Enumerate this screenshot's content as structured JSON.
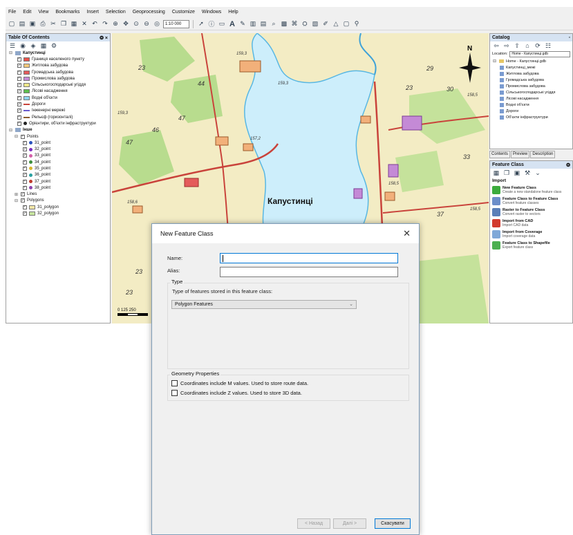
{
  "menu": [
    "File",
    "Edit",
    "View",
    "Bookmarks",
    "Insert",
    "Selection",
    "Geoprocessing",
    "Customize",
    "Windows",
    "Help"
  ],
  "toolbar": {
    "scale": "1:10 000"
  },
  "toc": {
    "title": "Table Of Contents",
    "pin": "❂ ×",
    "group1": "Капустинці",
    "layers": [
      {
        "label": "Границя населеного пункту",
        "color": "#e8524a"
      },
      {
        "label": "Житлова забудова",
        "color": "#f5c97a"
      },
      {
        "label": "Громадська забудова",
        "color": "#e45b5b"
      },
      {
        "label": "Промислова забудова",
        "color": "#c48ad6"
      },
      {
        "label": "Сільськогосподарські угіддя",
        "color": "#efe98a"
      },
      {
        "label": "Лісові насадження",
        "color": "#5fbf4f"
      },
      {
        "label": "Водні об'єкти",
        "color": "#8fd4ef"
      }
    ],
    "lines": [
      {
        "label": "Дороги",
        "color": "#c9433b"
      },
      {
        "label": "Інженерні мережі",
        "color": "#6a5acd"
      },
      {
        "label": "Рельєф (горизонталі)",
        "color": "#8a5a2b"
      },
      {
        "label": "Орієнтири, об'єкти інфраструктури",
        "color": "#222222"
      }
    ],
    "group2": "Інше",
    "points_label": "Points",
    "points": [
      {
        "label": "31_point",
        "color": "#2a52be"
      },
      {
        "label": "32_point",
        "color": "#7b2cbf"
      },
      {
        "label": "33_point",
        "color": "#d45fa8"
      },
      {
        "label": "34_point",
        "color": "#3c8d3c"
      },
      {
        "label": "35_point",
        "color": "#d8b62e"
      },
      {
        "label": "36_point",
        "color": "#2aa1a1"
      },
      {
        "label": "37_point",
        "color": "#c0392b"
      },
      {
        "label": "38_point",
        "color": "#8e44ad"
      }
    ],
    "lines_label": "Lines",
    "polygons_label": "Polygons",
    "polygons": [
      {
        "label": "31_polygon",
        "color": "#f6e7a8"
      },
      {
        "label": "32_polygon",
        "color": "#c8e6a0"
      }
    ]
  },
  "map": {
    "town": "Капустинці",
    "north": "N",
    "numbers": [
      "23",
      "44",
      "47",
      "46",
      "47",
      "29",
      "23",
      "30",
      "33",
      "37",
      "23",
      "23",
      "159,3",
      "159,3",
      "157,2",
      "158,5",
      "158,6",
      "158,5",
      "159,3",
      "158,5"
    ],
    "scalebar": "0   125  250"
  },
  "catalog": {
    "title": "Catalog",
    "location_label": "Location:",
    "location_value": "Home - Капустинці.gdb",
    "root": "Home - Капустинці.gdb",
    "items": [
      "Капустинці_межі",
      "Житлова забудова",
      "Громадська забудова",
      "Промислова забудова",
      "Сільськогосподарські угіддя",
      "Лісові насадження",
      "Водні об'єкти",
      "Дороги",
      "Об'єкти інфраструктури"
    ],
    "tabs": [
      "Contents",
      "Preview",
      "Description"
    ]
  },
  "feature_class": {
    "title": "Feature Class",
    "pin": "❂",
    "section": "Import",
    "items": [
      {
        "title": "New Feature Class",
        "desc": "Create a new standalone feature class",
        "color": "#3cab3c"
      },
      {
        "title": "Feature Class to Feature Class",
        "desc": "Convert feature classes",
        "color": "#6c8ec9"
      },
      {
        "title": "Raster to Feature Class",
        "desc": "Convert raster to vectors",
        "color": "#5a7fb8"
      },
      {
        "title": "Import from CAD",
        "desc": "Import CAD data",
        "color": "#d23a2e"
      },
      {
        "title": "Import from Coverage",
        "desc": "Import coverage data",
        "color": "#7fa8d8"
      },
      {
        "title": "Feature Class to Shapefile",
        "desc": "Export feature class",
        "color": "#4caf50"
      }
    ]
  },
  "dialog": {
    "title": "New Feature Class",
    "close": "✕",
    "name_label": "Name:",
    "name_value": "",
    "alias_label": "Alias:",
    "alias_value": "",
    "type_group": "Type",
    "type_prompt": "Type of features stored in this feature class:",
    "type_selected": "Polygon Features",
    "geom_group": "Geometry Properties",
    "m_values": "Coordinates include M values. Used to store route data.",
    "z_values": "Coordinates include Z values. Used to store 3D data.",
    "back": "< Назад",
    "next": "Далі >",
    "cancel": "Скасувати"
  }
}
